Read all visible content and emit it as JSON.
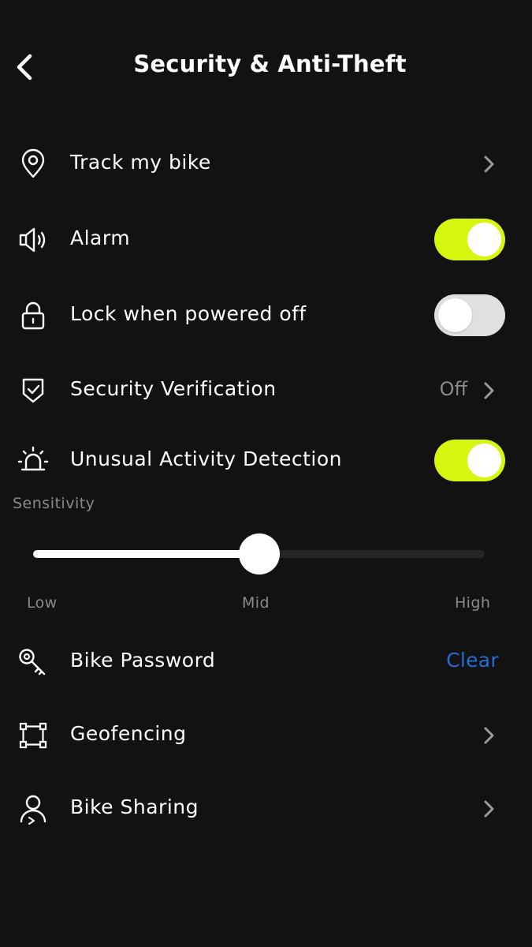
{
  "header": {
    "title": "Security & Anti-Theft",
    "back_icon": "chevron-left-icon"
  },
  "rows": {
    "track": {
      "label": "Track my bike",
      "icon": "location-pin-icon"
    },
    "alarm": {
      "label": "Alarm",
      "icon": "speaker-icon",
      "enabled": true
    },
    "lock": {
      "label": "Lock when powered off",
      "icon": "lock-icon",
      "enabled": false
    },
    "verification": {
      "label": "Security Verification",
      "icon": "shield-check-icon",
      "value": "Off"
    },
    "unusual": {
      "label": "Unusual Activity Detection",
      "icon": "siren-icon",
      "enabled": true
    },
    "password": {
      "label": "Bike Password",
      "icon": "key-icon",
      "action": "Clear"
    },
    "geofencing": {
      "label": "Geofencing",
      "icon": "geofence-icon"
    },
    "sharing": {
      "label": "Bike Sharing",
      "icon": "person-share-icon"
    }
  },
  "sensitivity": {
    "label": "Sensitivity",
    "levels": [
      "Low",
      "Mid",
      "High"
    ],
    "value": 0.5
  },
  "colors": {
    "background": "#121212",
    "toggle_on": "#d6f60f",
    "toggle_off": "#e0e0e0",
    "link": "#1f6fd6",
    "muted_text": "#8a8a8a"
  }
}
